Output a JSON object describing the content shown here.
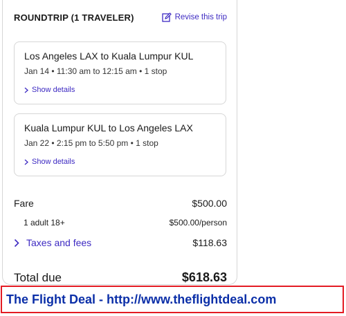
{
  "header": {
    "title": "ROUNDTRIP (1 TRAVELER)",
    "revise_label": "Revise this trip"
  },
  "legs": [
    {
      "route": "Los Angeles LAX to Kuala Lumpur KUL",
      "meta": "Jan 14 • 11:30 am to 12:15 am • 1 stop",
      "details_label": "Show details"
    },
    {
      "route": "Kuala Lumpur KUL to Los Angeles LAX",
      "meta": "Jan 22 • 2:15 pm to 5:50 pm • 1 stop",
      "details_label": "Show details"
    }
  ],
  "pricing": {
    "fare_label": "Fare",
    "fare_value": "$500.00",
    "adult_label": "1 adult 18+",
    "adult_value": "$500.00/person",
    "taxes_label": "Taxes and fees",
    "taxes_value": "$118.63",
    "total_label": "Total due",
    "total_value": "$618.63"
  },
  "banner": {
    "text": "The Flight Deal - http://www.theflightdeal.com"
  },
  "colors": {
    "accent": "#3d2ac2",
    "banner_text": "#0b2fa8",
    "banner_border": "#e31b23"
  }
}
